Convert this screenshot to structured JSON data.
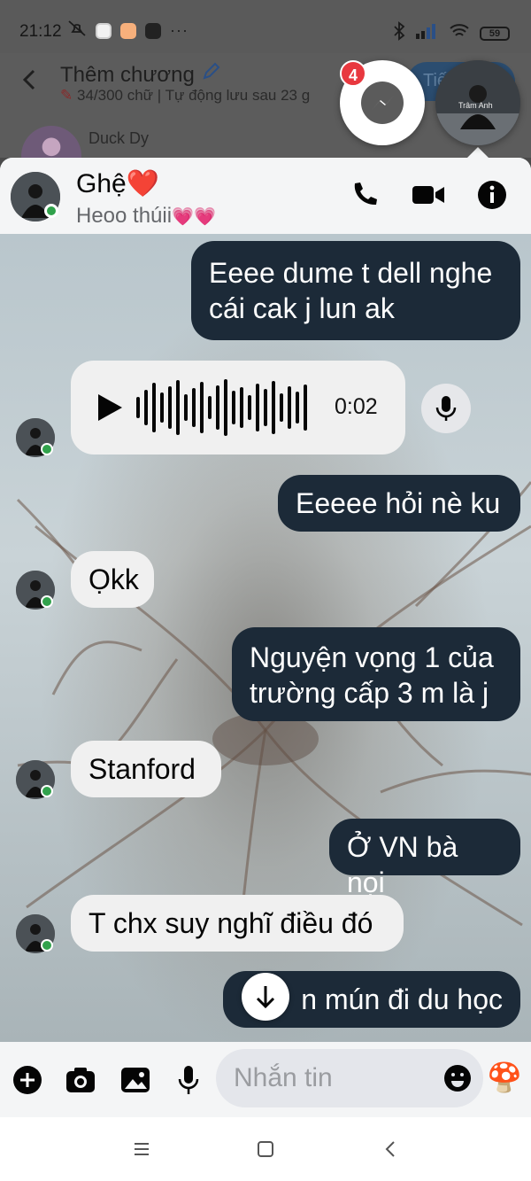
{
  "status_bar": {
    "time": "21:12",
    "battery": "59",
    "more": "···"
  },
  "background_app": {
    "title": "Thêm chương",
    "subtitle": "34/300 chữ | Tự động lưu sau 23 g",
    "next_button": "Tiế",
    "author_name": "Duck Dy"
  },
  "chat_heads": {
    "badge_count": "4",
    "avatar_caption": "Trâm Anh"
  },
  "chat": {
    "contact_name": "Ghệ",
    "name_emoji": "❤️",
    "status": "Heoo thúii",
    "status_emoji": "💗💗",
    "messages": [
      {
        "dir": "out",
        "lines": [
          "Eeee dume t dell nghe",
          "cái cak j lun ak"
        ]
      },
      {
        "dir": "in",
        "type": "voice",
        "duration": "0:02"
      },
      {
        "dir": "out",
        "lines": [
          "Eeeee hỏi nè ku"
        ]
      },
      {
        "dir": "in",
        "lines": [
          "Ọkk"
        ]
      },
      {
        "dir": "out",
        "lines": [
          "Nguyện vọng 1 của",
          "trường cấp 3 m là j"
        ]
      },
      {
        "dir": "in",
        "lines": [
          "Stanford"
        ]
      },
      {
        "dir": "out",
        "lines": [
          "Ở VN bà nọi"
        ]
      },
      {
        "dir": "in",
        "lines": [
          "T chx suy nghĩ điều đó"
        ]
      },
      {
        "dir": "out",
        "lines": [
          "n mún đi du học"
        ]
      }
    ]
  },
  "composer": {
    "placeholder": "Nhắn tin",
    "react_emoji": "🍄"
  },
  "colors": {
    "outgoing_bubble": "#1c2a38",
    "incoming_bubble": "#f0f0f0",
    "online": "#31a24c",
    "badge": "#e8383f"
  }
}
